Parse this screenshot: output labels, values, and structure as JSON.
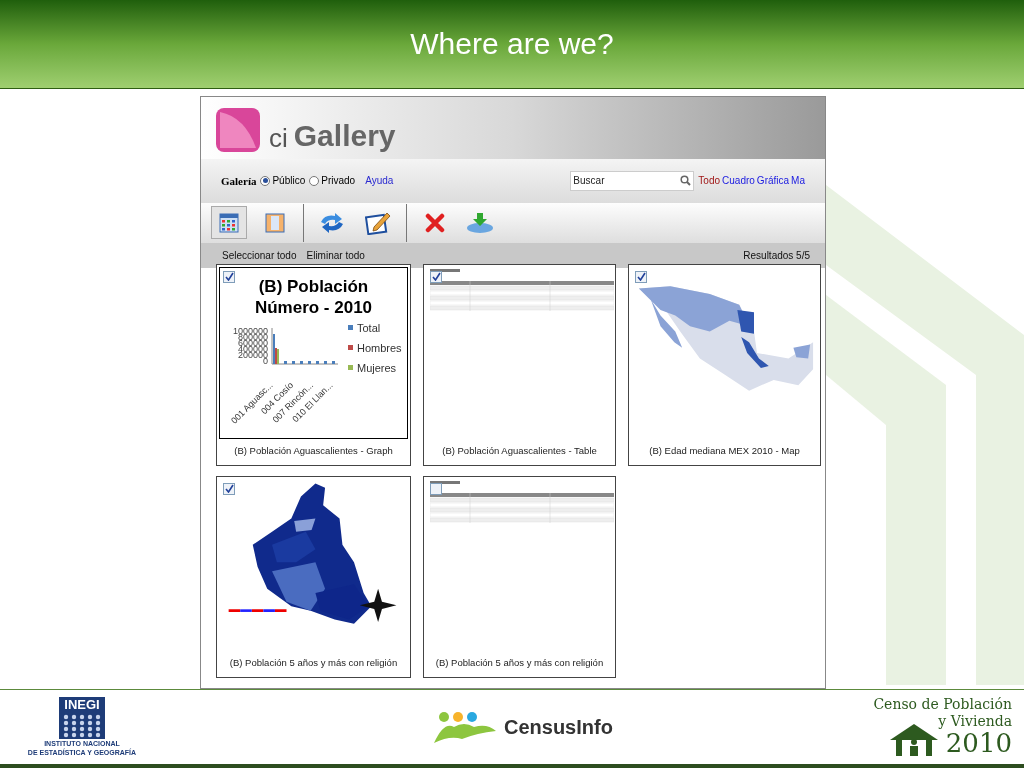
{
  "slide": {
    "title": "Where are we?"
  },
  "banner": {
    "prefix": "ci",
    "name": "Gallery"
  },
  "filter_bar": {
    "label": "Galería",
    "options": [
      {
        "label": "Público",
        "selected": true
      },
      {
        "label": "Privado",
        "selected": false
      }
    ],
    "help_link": "Ayuda",
    "search": {
      "placeholder": "Buscar"
    },
    "type_links": [
      {
        "label": "Todo",
        "selected": true
      },
      {
        "label": "Cuadro",
        "selected": false
      },
      {
        "label": "Gráfica",
        "selected": false
      },
      {
        "label": "Ma",
        "selected": false
      }
    ]
  },
  "toolbar": {
    "groups": [
      [
        {
          "kind": "grid",
          "selected": true
        },
        {
          "kind": "columns",
          "selected": false
        }
      ],
      [
        {
          "kind": "refresh",
          "selected": false
        },
        {
          "kind": "edit",
          "selected": false
        }
      ],
      [
        {
          "kind": "delete",
          "selected": false
        },
        {
          "kind": "download",
          "selected": false
        }
      ]
    ]
  },
  "action_bar": {
    "links": [
      "Seleccionar todo",
      "Eliminar todo"
    ],
    "results": "Resultados 5/5"
  },
  "items": [
    {
      "kind": "graph",
      "checked": true,
      "caption": "(B) Población Aguascalientes - Graph",
      "title_lines": [
        "(B) Población",
        "Número - 2010"
      ],
      "yticks": [
        "1000000",
        "800000",
        "600000",
        "400000",
        "200000",
        "0"
      ],
      "xlabels": [
        "001 Aguasc...",
        "004  Cosío",
        "007 Rincón...",
        "010 El Llan..."
      ],
      "legend": [
        {
          "label": "Total",
          "color": "#4a7ebb"
        },
        {
          "label": "Hombres",
          "color": "#be4b48"
        },
        {
          "label": "Mujeres",
          "color": "#98b954"
        }
      ]
    },
    {
      "kind": "table",
      "checked": true,
      "caption": "(B) Población Aguascalientes - Table"
    },
    {
      "kind": "country-map",
      "checked": true,
      "caption": "(B) Edad mediana MEX 2010 - Map"
    },
    {
      "kind": "city-map",
      "checked": true,
      "caption": "(B) Población 5 años y más con religión"
    },
    {
      "kind": "table",
      "checked": false,
      "caption": "(B) Población 5 años y más con religión"
    }
  ],
  "footer": {
    "inegi": {
      "acronym": "INEGI",
      "lines": [
        "INSTITUTO NACIONAL",
        "DE ESTADÍSTICA Y GEOGRAFÍA"
      ]
    },
    "censusinfo": "CensusInfo",
    "census": {
      "lines": [
        "Censo de Población",
        "y Vivienda"
      ],
      "year": "2010"
    }
  }
}
